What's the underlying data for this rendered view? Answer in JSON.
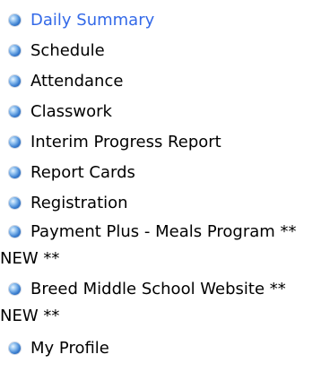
{
  "menu": {
    "accent_color": "#3369e8",
    "bullet_icon": "blue-globe-bullet",
    "items": [
      {
        "label": "Daily Summary",
        "active": true
      },
      {
        "label": "Schedule"
      },
      {
        "label": "Attendance"
      },
      {
        "label": "Classwork"
      },
      {
        "label": "Interim Progress Report"
      },
      {
        "label": "Report Cards"
      },
      {
        "label": "Registration"
      },
      {
        "label": "Payment Plus - Meals Program ** NEW **"
      },
      {
        "label": "Breed Middle School Website ** NEW **"
      },
      {
        "label": "My Profile"
      }
    ]
  }
}
